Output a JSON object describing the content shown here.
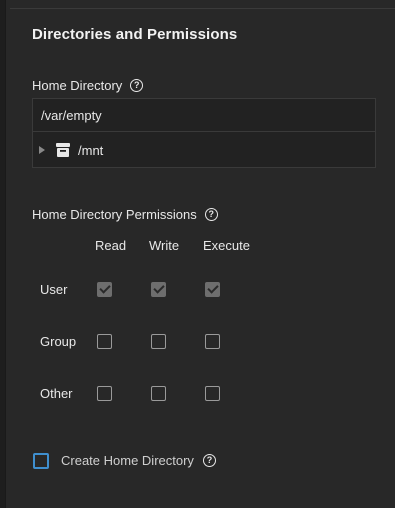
{
  "section": {
    "title": "Directories and Permissions"
  },
  "home_directory": {
    "label": "Home Directory",
    "value": "/var/empty",
    "tree_item": "/mnt"
  },
  "permissions": {
    "label": "Home Directory Permissions",
    "columns": [
      "Read",
      "Write",
      "Execute"
    ],
    "rows": [
      {
        "label": "User",
        "read": true,
        "write": true,
        "execute": true
      },
      {
        "label": "Group",
        "read": false,
        "write": false,
        "execute": false
      },
      {
        "label": "Other",
        "read": false,
        "write": false,
        "execute": false
      }
    ]
  },
  "create_home": {
    "label": "Create Home Directory",
    "checked": false
  },
  "icons": {
    "help": "help-circle-icon",
    "dataset": "database-icon",
    "expand": "caret-right-icon"
  },
  "colors": {
    "checkbox_accent": "#3f8fcf",
    "background": "#282828"
  }
}
